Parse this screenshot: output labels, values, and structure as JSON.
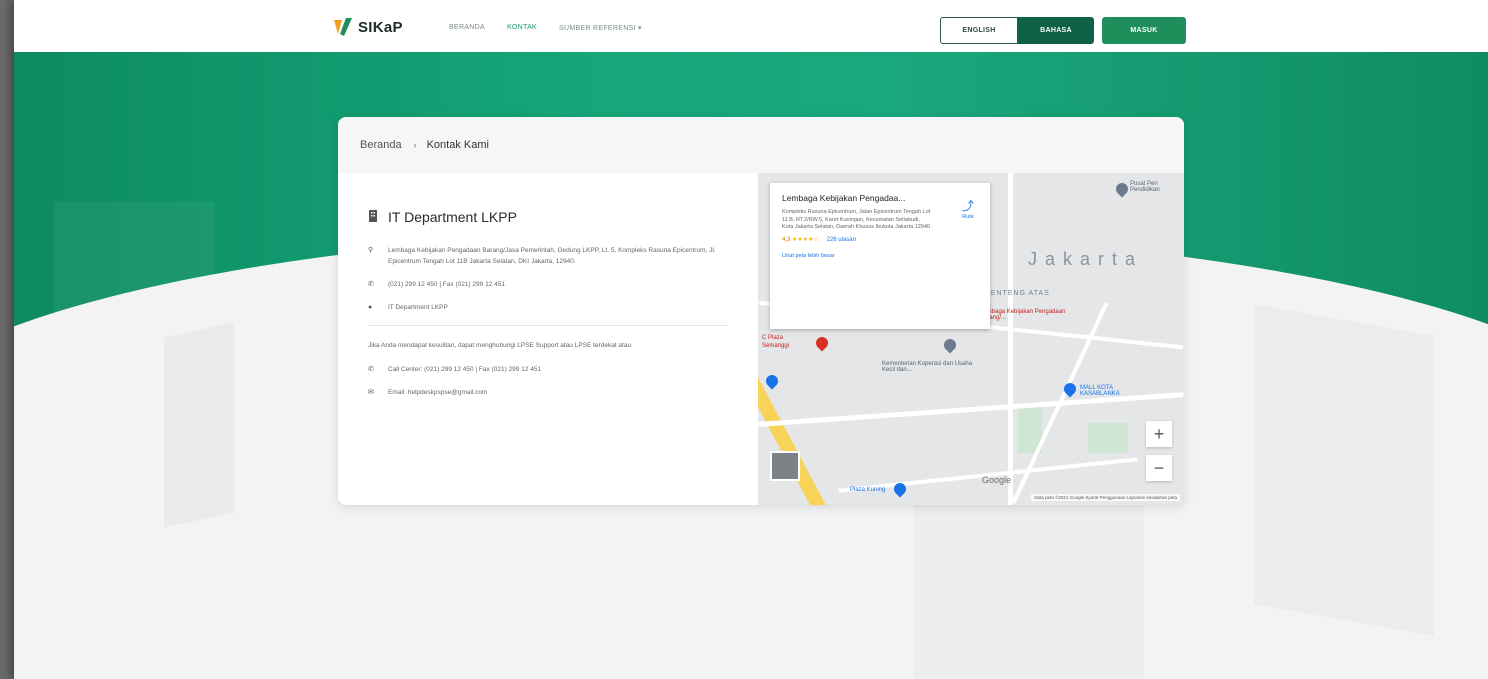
{
  "header": {
    "logo_text": "SIKaP",
    "nav": [
      "BERANDA",
      "KONTAK",
      "SUMBER REFERENSI ▾"
    ],
    "btn_english": "ENGLISH",
    "btn_bahasa": "BAHASA",
    "btn_masuk": "MASUK"
  },
  "breadcrumb": {
    "home": "Beranda",
    "sep": "›",
    "current": "Kontak Kami"
  },
  "info": {
    "dept_title": "IT Department LKPP",
    "address": "Lembaga Kebijakan Pengadaan Barang/Jasa Pemerintah, Gedung LKPP, Lt. 5, Kompleks Rasuna Epicentrum, Jl. Epicentrum Tengah Lot 11B Jakarta Selatan, DKI Jakarta, 12940.",
    "phone": "(021) 299 12 450 | Fax (021) 299 12 451",
    "unit": "IT Department LKPP",
    "help_text": "Jika Anda mendapat kesulitan, dapat menghubungi LPSE Support atau LPSE terdekat atau",
    "call_center": "Call Center: (021) 299 12 450 | Fax (021) 299 12 451",
    "email": "Email: helpdeskpspse@gmail.com"
  },
  "map": {
    "popup_title": "Lembaga Kebijakan Pengadaa...",
    "popup_address": "Kompleks Rasuna Epicentrum, Jalan Epicentrum Tengah Lot 11 B, RT.2/RW.5, Karet Kuningan, Kecamatan Setiabudi, Kota Jakarta Selatan, Daerah Khusus Ibukota Jakarta 12940",
    "rating": "4,3",
    "stars": "★★★★☆",
    "reviews": "226 ulasan",
    "larger_map": "Lihat peta lebih besar",
    "directions": "Rute",
    "city_label": "Jakarta",
    "area_label": "MENTENG ATAS",
    "poi_pusat": "Pusat Pen Pendidikan",
    "poi_lembaga": "Lembaga Kebijakan Pengadaan Barang/...",
    "poi_kementerian": "Kementerian Koperasi dan Usaha Kecil dan...",
    "poi_mall": "MALL KOTA KASABLANKA",
    "poi_semanggi": "Semanggi",
    "poi_semanggi_pre": "C Plaza",
    "poi_bawah": "Plaza Kuning",
    "zoom_in": "+",
    "zoom_out": "−",
    "google": "Google",
    "attribution": "Data peta ©2021 Google   Syarat Penggunaan   Laporkan kesalahan peta"
  },
  "colors": {
    "primary": "#16a67a",
    "dark_green": "#0e6147",
    "button_green": "#1e8f5a"
  }
}
